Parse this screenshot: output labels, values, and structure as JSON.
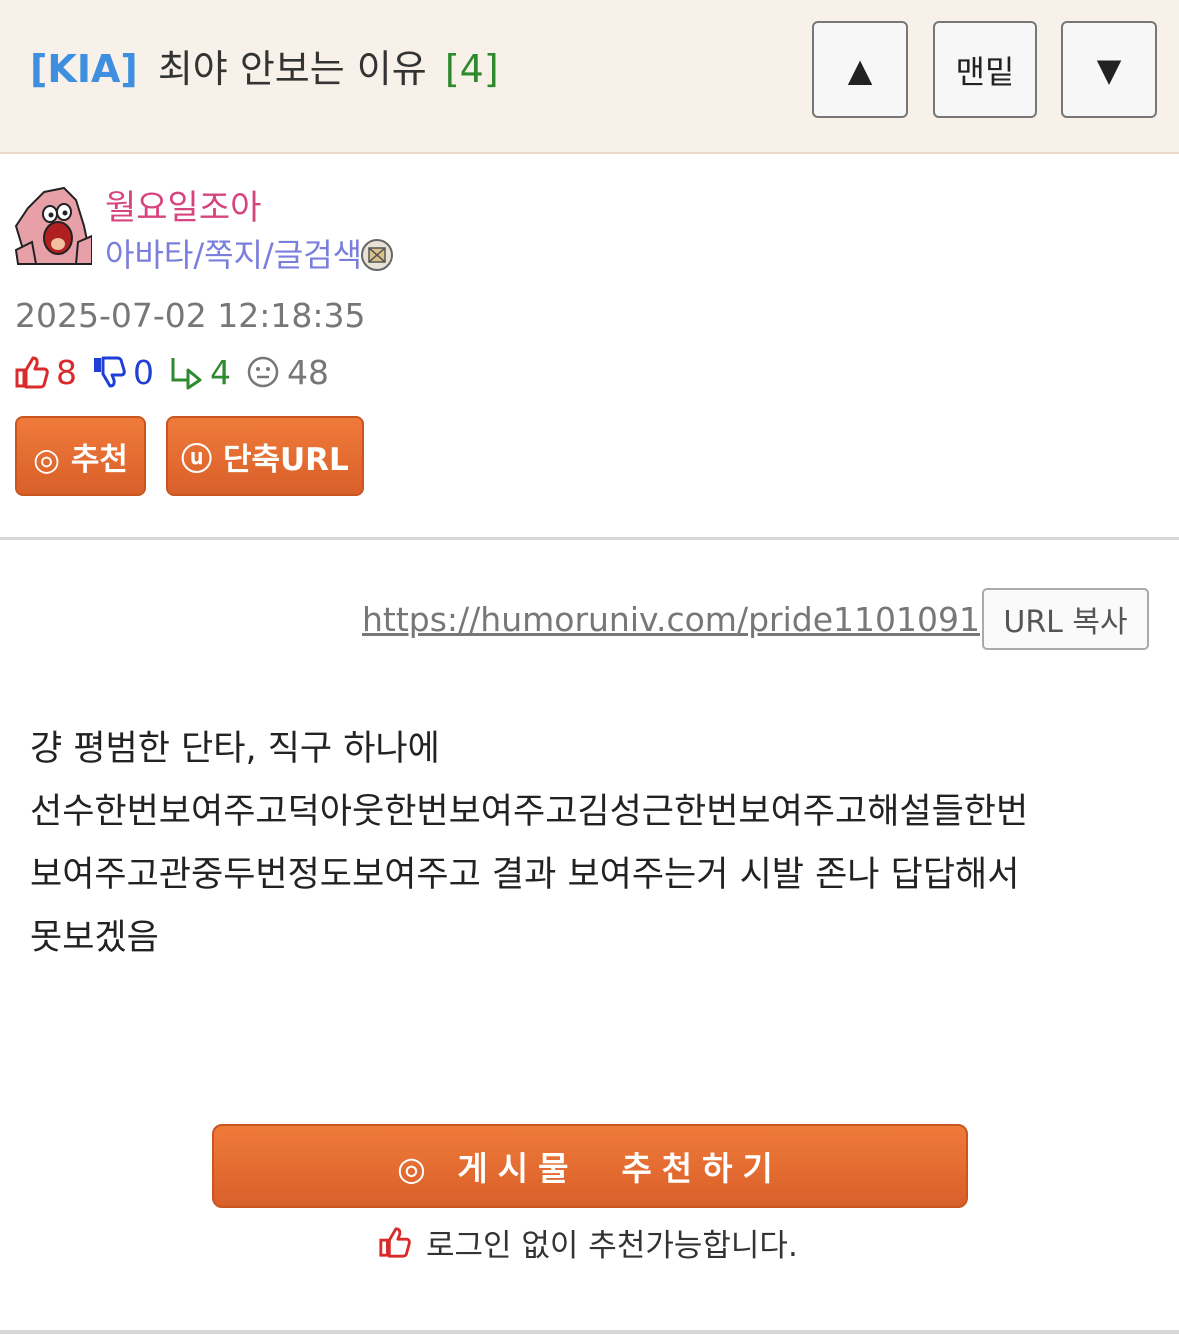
{
  "header": {
    "tag": "[KIA]",
    "title": "최야 안보는 이유",
    "comment_count": "[4]",
    "btn_up": "▲",
    "btn_bottom": "맨밑",
    "btn_down": "▼"
  },
  "author": {
    "nickname": "월요일조아",
    "links": "아바타/쪽지/글검색",
    "date": "2025-07-02 12:18:35"
  },
  "stats": {
    "up": "8",
    "down": "0",
    "replies": "4",
    "views": "48"
  },
  "buttons": {
    "recommend": "◎ 추천",
    "short_url": "ⓤ 단축URL",
    "url_copy": "URL 복사",
    "big_recommend": "◎ 게시물  추천하기",
    "no_login_note": "로그인 없이 추천가능합니다."
  },
  "url": "https://humoruniv.com/pride1101091",
  "content_lines": [
    "걍 평범한 단타, 직구 하나에",
    "선수한번보여주고덕아웃한번보여주고김성근한번보여주고해설들한번",
    "보여주고관중두번정도보여주고 결과 보여주는거 시발 존나 답답해서",
    "못보겠음"
  ],
  "colors": {
    "tag": "#3f8fe0",
    "comment_count": "#2f8a2f",
    "nickname": "#d6457e",
    "links": "#7b7fdc",
    "orange_button": "#e06a2e",
    "header_bg": "#f8f1ea"
  },
  "icons": [
    "thumbs-up-icon",
    "thumbs-down-icon",
    "reply-arrow-icon",
    "smiley-view-icon",
    "mail-icon",
    "avatar-patrick"
  ]
}
